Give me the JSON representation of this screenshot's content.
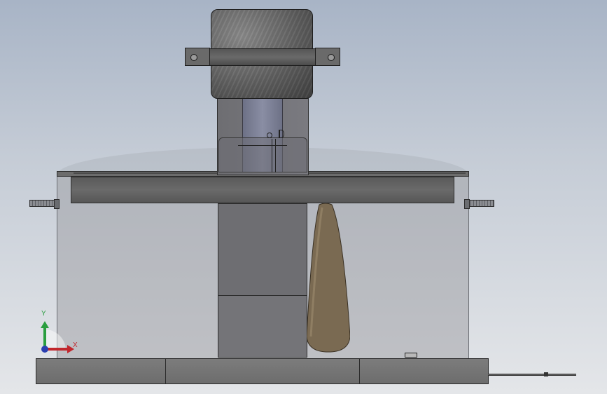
{
  "view": {
    "background_top": "#a8b4c6",
    "background_bottom": "#e4e6e9"
  },
  "colors": {
    "axis_x": "#c1272d",
    "axis_y": "#2a9e3f",
    "axis_z": "#2b3fb0",
    "sleeve": "#7a6a52",
    "steel": "#6e6e72",
    "motor": "#5c5c5c"
  },
  "triad": {
    "x_label": "X",
    "y_label": "Y"
  },
  "icons": {
    "motor": "motor-icon",
    "bolt": "bolt-icon",
    "axis_triad": "axis-triad-icon"
  }
}
